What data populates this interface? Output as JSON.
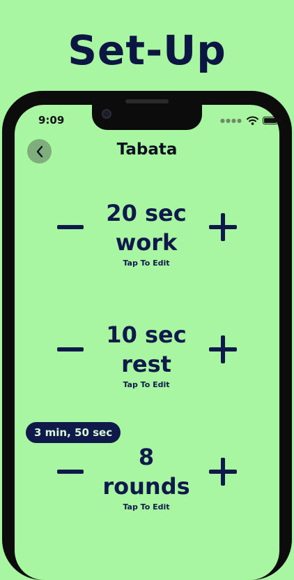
{
  "headline": "Set-Up",
  "status_bar": {
    "time": "9:09"
  },
  "nav": {
    "title": "Tabata"
  },
  "settings": [
    {
      "value": "20 sec",
      "label": "work",
      "hint": "Tap To Edit"
    },
    {
      "value": "10 sec",
      "label": "rest",
      "hint": "Tap To Edit"
    },
    {
      "value": "8",
      "label": "rounds",
      "hint": "Tap To Edit"
    }
  ],
  "total_badge": "3 min, 50 sec",
  "colors": {
    "background": "#a8f5a2",
    "accent": "#0f1a4a"
  }
}
